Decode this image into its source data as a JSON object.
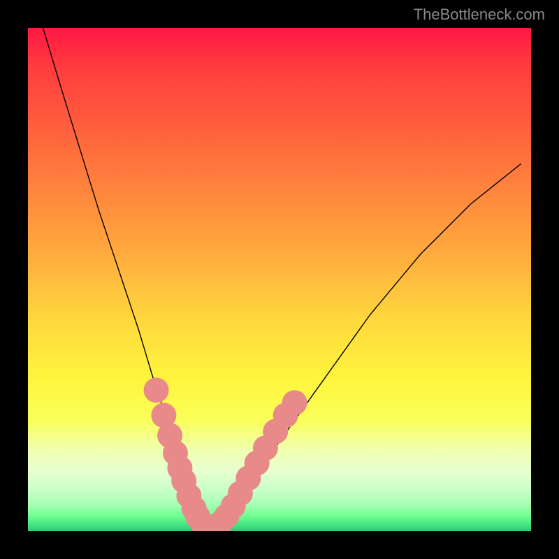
{
  "watermark": "TheBottleneck.com",
  "chart_data": {
    "type": "line",
    "title": "",
    "xlabel": "",
    "ylabel": "",
    "xlim": [
      0,
      100
    ],
    "ylim": [
      0,
      100
    ],
    "grid": false,
    "legend": false,
    "series": [
      {
        "name": "curve",
        "x": [
          3,
          6,
          10,
          14,
          18,
          22,
          25,
          28,
          30,
          32,
          33.5,
          35,
          36.5,
          38,
          41,
          44,
          48,
          53,
          58,
          63,
          68,
          73,
          78,
          83,
          88,
          93,
          98
        ],
        "y": [
          100,
          90,
          77,
          64,
          52,
          40,
          30,
          21,
          14,
          8,
          4,
          1.5,
          0.5,
          1,
          4,
          9,
          15,
          22,
          29,
          36,
          43,
          49,
          55,
          60,
          65,
          69,
          73
        ]
      }
    ],
    "markers": [
      {
        "x": 25.5,
        "y": 28
      },
      {
        "x": 27.0,
        "y": 23
      },
      {
        "x": 28.2,
        "y": 19
      },
      {
        "x": 29.3,
        "y": 15.5
      },
      {
        "x": 30.2,
        "y": 12.5
      },
      {
        "x": 31.0,
        "y": 10
      },
      {
        "x": 32.0,
        "y": 7
      },
      {
        "x": 33.0,
        "y": 4.5
      },
      {
        "x": 33.8,
        "y": 2.8
      },
      {
        "x": 34.8,
        "y": 1.3
      },
      {
        "x": 36.0,
        "y": 0.5
      },
      {
        "x": 37.0,
        "y": 0.6
      },
      {
        "x": 38.2,
        "y": 1.5
      },
      {
        "x": 39.5,
        "y": 3
      },
      {
        "x": 40.8,
        "y": 5
      },
      {
        "x": 42.2,
        "y": 7.5
      },
      {
        "x": 43.8,
        "y": 10.5
      },
      {
        "x": 45.5,
        "y": 13.5
      },
      {
        "x": 47.2,
        "y": 16.5
      },
      {
        "x": 49.2,
        "y": 19.8
      },
      {
        "x": 51.2,
        "y": 23
      },
      {
        "x": 53.0,
        "y": 25.5
      }
    ],
    "marker_color": "#e88a8a",
    "marker_radius": 2.5,
    "curve_color": "#000000"
  }
}
